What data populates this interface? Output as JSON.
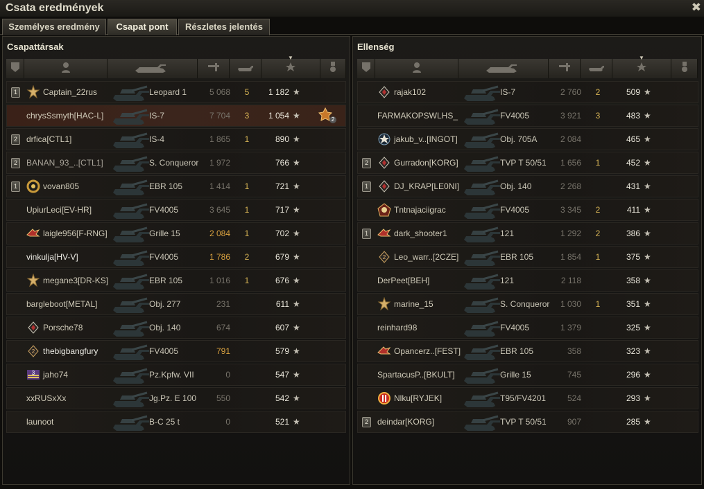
{
  "window": {
    "title": "Csata eredmények"
  },
  "tabs": [
    {
      "label": "Személyes eredmény",
      "active": false
    },
    {
      "label": "Csapat pont",
      "active": true
    },
    {
      "label": "Részletes jelentés",
      "active": false
    }
  ],
  "colors": {
    "accent_gold": "#d9a240",
    "kills_yellow": "#d6b355",
    "self_row": "#3b251c"
  },
  "columns_icons": [
    "platoon-icon",
    "player-icon",
    "tank-icon",
    "damage-icon",
    "kills-icon",
    "xp-star-icon",
    "medal-icon"
  ],
  "left": {
    "title": "Csapattársak",
    "rows": [
      {
        "rank": "1",
        "badge": "gold-star",
        "name": "Captain_22rus",
        "tank": "Leopard 1",
        "damage": "5 068",
        "kills": "5",
        "xp": "1 182",
        "style": "normal"
      },
      {
        "rank": "",
        "badge": "",
        "name": "chrysSsmyth[HAC-L]",
        "tank": "IS-7",
        "damage": "7 704",
        "kills": "3",
        "xp": "1 054",
        "style": "self",
        "medal": "2"
      },
      {
        "rank": "2",
        "badge": "",
        "name": "drfica[CTL1]",
        "tank": "IS-4",
        "damage": "1 865",
        "kills": "1",
        "xp": "890",
        "style": "normal"
      },
      {
        "rank": "2",
        "badge": "",
        "name": "BANAN_93_..[CTL1]",
        "tank": "S. Conqueror",
        "damage": "1 972",
        "kills": "",
        "xp": "766",
        "style": "dim"
      },
      {
        "rank": "1",
        "badge": "laurel",
        "name": "vovan805",
        "tank": "EBR 105",
        "damage": "1 414",
        "kills": "1",
        "xp": "721",
        "style": "normal"
      },
      {
        "rank": "",
        "badge": "",
        "name": "UpiurLeci[EV-HR]",
        "tank": "FV4005",
        "damage": "3 645",
        "kills": "1",
        "xp": "717",
        "style": "normal"
      },
      {
        "rank": "",
        "badge": "wing",
        "name": "laigle956[F-RNG]",
        "tank": "Grille 15",
        "damage": "2 084",
        "kills": "1",
        "xp": "702",
        "style": "normal",
        "damageHi": true
      },
      {
        "rank": "",
        "badge": "",
        "name": "vinkulja[HV-V]",
        "tank": "FV4005",
        "damage": "1 786",
        "kills": "2",
        "xp": "679",
        "style": "bright",
        "damageHi": true
      },
      {
        "rank": "",
        "badge": "gold-star",
        "name": "megane3[DR-KS]",
        "tank": "EBR 105",
        "damage": "1 016",
        "kills": "1",
        "xp": "676",
        "style": "normal"
      },
      {
        "rank": "",
        "badge": "",
        "name": "bargleboot[METAL]",
        "tank": "Obj. 277",
        "damage": "231",
        "kills": "",
        "xp": "611",
        "style": "normal"
      },
      {
        "rank": "",
        "badge": "diamond",
        "name": "Porsche78",
        "tank": "Obj. 140",
        "damage": "674",
        "kills": "",
        "xp": "607",
        "style": "normal"
      },
      {
        "rank": "",
        "badge": "diamond-2",
        "name": "thebigbangfury",
        "tank": "FV4005",
        "damage": "791",
        "kills": "",
        "xp": "579",
        "style": "bright",
        "damageHi": true
      },
      {
        "rank": "",
        "badge": "chevron-3",
        "name": "jaho74",
        "tank": "Pz.Kpfw. VII",
        "damage": "0",
        "kills": "",
        "xp": "547",
        "style": "normal"
      },
      {
        "rank": "",
        "badge": "",
        "name": "xxRUSxXx",
        "tank": "Jg.Pz. E 100",
        "damage": "550",
        "kills": "",
        "xp": "542",
        "style": "normal"
      },
      {
        "rank": "",
        "badge": "",
        "name": "launoot",
        "tank": "B-C 25 t",
        "damage": "0",
        "kills": "",
        "xp": "521",
        "style": "normal"
      }
    ]
  },
  "right": {
    "title": "Ellenség",
    "rows": [
      {
        "rank": "",
        "badge": "diamond",
        "name": "rajak102",
        "tank": "IS-7",
        "damage": "2 760",
        "kills": "2",
        "xp": "509"
      },
      {
        "rank": "",
        "badge": "",
        "name": "FARMAKOPSWLHS_",
        "tank": "FV4005",
        "damage": "3 921",
        "kills": "3",
        "xp": "483"
      },
      {
        "rank": "",
        "badge": "star-circle",
        "name": "jakub_v..[INGOT]",
        "tank": "Obj. 705A",
        "damage": "2 084",
        "kills": "",
        "xp": "465"
      },
      {
        "rank": "2",
        "badge": "diamond",
        "name": "Gurradon[KORG]",
        "tank": "TVP T 50/51",
        "damage": "1 656",
        "kills": "1",
        "xp": "452"
      },
      {
        "rank": "1",
        "badge": "diamond",
        "name": "DJ_KRAP[LE0NI]",
        "tank": "Obj. 140",
        "damage": "2 268",
        "kills": "",
        "xp": "431"
      },
      {
        "rank": "",
        "badge": "pentagon",
        "name": "Tntnajaciigrac",
        "tank": "FV4005",
        "damage": "3 345",
        "kills": "2",
        "xp": "411"
      },
      {
        "rank": "1",
        "badge": "wing",
        "name": "dark_shooter1",
        "tank": "121",
        "damage": "1 292",
        "kills": "2",
        "xp": "386"
      },
      {
        "rank": "",
        "badge": "diamond-2",
        "name": "Leo_warr..[2CZE]",
        "tank": "EBR 105",
        "damage": "1 854",
        "kills": "1",
        "xp": "375"
      },
      {
        "rank": "",
        "badge": "",
        "name": "DerPeet[BEH]",
        "tank": "121",
        "damage": "2 118",
        "kills": "",
        "xp": "358"
      },
      {
        "rank": "",
        "badge": "gold-star",
        "name": "marine_15",
        "tank": "S. Conqueror",
        "damage": "1 030",
        "kills": "1",
        "xp": "351"
      },
      {
        "rank": "",
        "badge": "",
        "name": "reinhard98",
        "tank": "FV4005",
        "damage": "1 379",
        "kills": "",
        "xp": "325"
      },
      {
        "rank": "",
        "badge": "wing",
        "name": "Opancerz..[FEST]",
        "tank": "EBR 105",
        "damage": "358",
        "kills": "",
        "xp": "323"
      },
      {
        "rank": "",
        "badge": "",
        "name": "SpartacusP..[BKULT]",
        "tank": "Grille 15",
        "damage": "745",
        "kills": "",
        "xp": "296"
      },
      {
        "rank": "",
        "badge": "red-circle",
        "name": "Nlku[RYJEK]",
        "tank": "T95/FV4201",
        "damage": "524",
        "kills": "",
        "xp": "293"
      },
      {
        "rank": "2",
        "badge": "",
        "name": "deindar[KORG]",
        "tank": "TVP T 50/51",
        "damage": "907",
        "kills": "",
        "xp": "285"
      }
    ]
  }
}
